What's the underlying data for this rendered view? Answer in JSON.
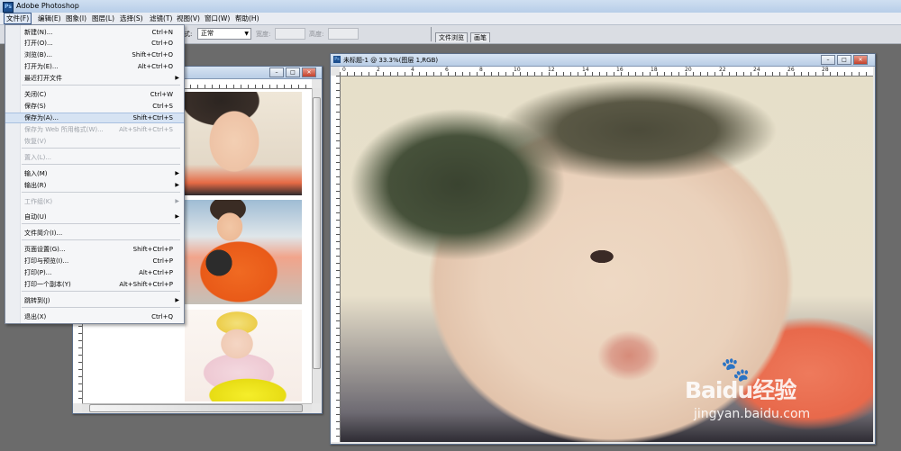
{
  "app": {
    "title": "Adobe Photoshop"
  },
  "menubar": {
    "items": [
      "文件(F)",
      "编辑(E)",
      "图象(I)",
      "图层(L)",
      "选择(S)",
      "滤镜(T)",
      "视图(V)",
      "窗口(W)",
      "帮助(H)"
    ]
  },
  "options_bar": {
    "style_label": "式:",
    "style_value": "正常",
    "width_label": "宽度:",
    "height_label": "高度:"
  },
  "palette_well": {
    "tabs": [
      "文件浏览",
      "画笔"
    ]
  },
  "file_menu": {
    "items": [
      {
        "label": "新建(N)...",
        "shortcut": "Ctrl+N",
        "disabled": false
      },
      {
        "label": "打开(O)...",
        "shortcut": "Ctrl+O",
        "disabled": false
      },
      {
        "label": "浏览(B)...",
        "shortcut": "Shift+Ctrl+O",
        "disabled": false
      },
      {
        "label": "打开为(E)...",
        "shortcut": "Alt+Ctrl+O",
        "disabled": false
      },
      {
        "label": "最近打开文件",
        "shortcut": "",
        "submenu": true,
        "disabled": false
      },
      {
        "label": "关闭(C)",
        "shortcut": "Ctrl+W",
        "disabled": false
      },
      {
        "label": "保存(S)",
        "shortcut": "Ctrl+S",
        "disabled": false
      },
      {
        "label": "保存为(A)...",
        "shortcut": "Shift+Ctrl+S",
        "disabled": false,
        "highlighted": true
      },
      {
        "label": "保存为 Web 所用格式(W)...",
        "shortcut": "Alt+Shift+Ctrl+S",
        "disabled": true
      },
      {
        "label": "恢复(V)",
        "shortcut": "",
        "disabled": true
      },
      {
        "label": "置入(L)...",
        "shortcut": "",
        "disabled": true
      },
      {
        "label": "输入(M)",
        "shortcut": "",
        "submenu": true,
        "disabled": false
      },
      {
        "label": "输出(R)",
        "shortcut": "",
        "submenu": true,
        "disabled": false
      },
      {
        "label": "工作组(K)",
        "shortcut": "",
        "submenu": true,
        "disabled": true
      },
      {
        "label": "自动(U)",
        "shortcut": "",
        "submenu": true,
        "disabled": false
      },
      {
        "label": "文件简介(I)...",
        "shortcut": "",
        "disabled": false
      },
      {
        "label": "页面设置(G)...",
        "shortcut": "Shift+Ctrl+P",
        "disabled": false
      },
      {
        "label": "打印与预览(I)...",
        "shortcut": "Ctrl+P",
        "disabled": false
      },
      {
        "label": "打印(P)...",
        "shortcut": "Alt+Ctrl+P",
        "disabled": false
      },
      {
        "label": "打印一个副本(Y)",
        "shortcut": "Alt+Shift+Ctrl+P",
        "disabled": false
      },
      {
        "label": "跳转到(J)",
        "shortcut": "",
        "submenu": true,
        "disabled": false
      },
      {
        "label": "退出(X)",
        "shortcut": "Ctrl+Q",
        "disabled": false
      }
    ]
  },
  "main_document": {
    "title": "未标题-1 @ 33.3%(图层 1,RGB)",
    "ruler_numbers": [
      "0",
      "2",
      "4",
      "6",
      "8",
      "10",
      "12",
      "14",
      "16",
      "18",
      "20",
      "22",
      "24",
      "26",
      "28"
    ]
  },
  "left_document": {
    "title": ""
  },
  "watermark": {
    "brand": "Baidu经验",
    "site": "jingyan.baidu.com"
  },
  "colors": {
    "menubar_bg": "#e9ecf2",
    "workspace_bg": "#6b6b6b",
    "menu_highlight": "#d6e3f3"
  }
}
